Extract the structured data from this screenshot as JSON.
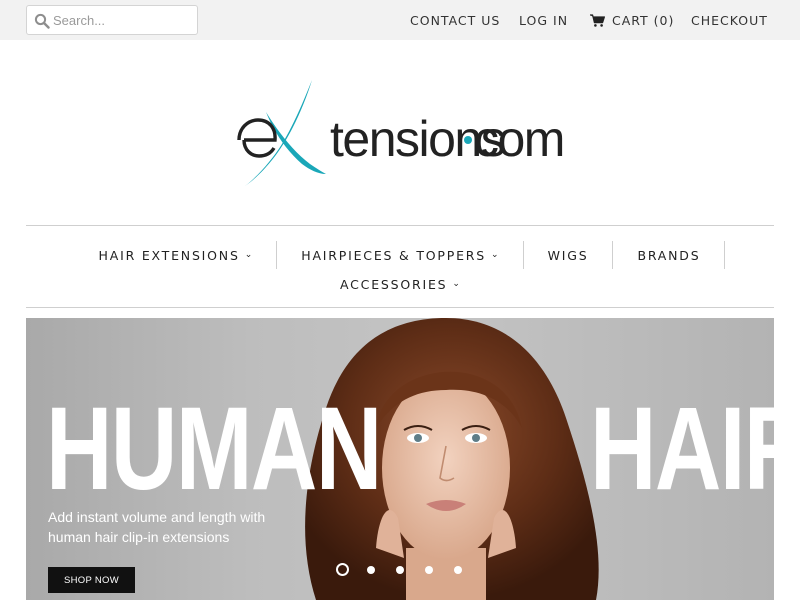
{
  "search": {
    "placeholder": "Search...",
    "value": ""
  },
  "toplinks": {
    "contact": "CONTACT US",
    "login": "LOG IN",
    "cart": "CART (0)",
    "checkout": "CHECKOUT"
  },
  "logo": {
    "text": "extensions.com",
    "accent_color": "#1aa7b8"
  },
  "nav": {
    "row1": [
      {
        "label": "HAIR EXTENSIONS",
        "dropdown": true
      },
      {
        "label": "HAIRPIECES & TOPPERS",
        "dropdown": true
      },
      {
        "label": "WIGS",
        "dropdown": false
      },
      {
        "label": "BRANDS",
        "dropdown": false
      }
    ],
    "row2": [
      {
        "label": "ACCESSORIES",
        "dropdown": true
      }
    ],
    "caret": "⌄"
  },
  "hero": {
    "title_left": "HUMAN",
    "title_right": "HAIR",
    "subtitle": "Add instant volume and length with human hair clip-in extensions",
    "cta": "SHOP NOW",
    "slides": 5,
    "active_slide": 1
  },
  "icons": {
    "search": "search-icon",
    "cart": "cart-icon"
  },
  "colors": {
    "topbar": "#f2f2f2",
    "brand_teal": "#1aa7b8",
    "text": "#222222",
    "button": "#111111"
  }
}
